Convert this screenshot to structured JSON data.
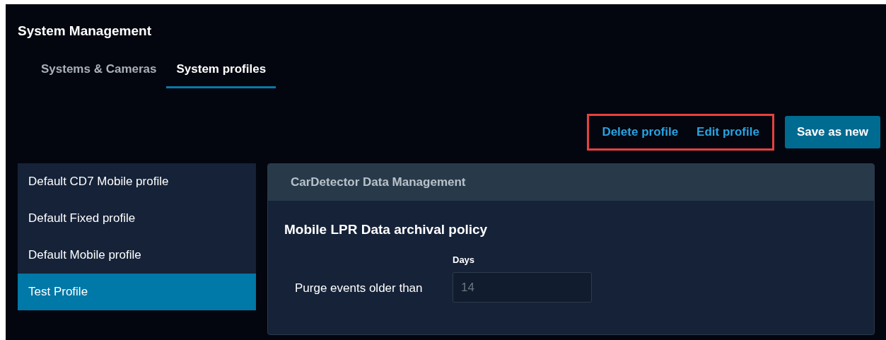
{
  "page": {
    "title": "System Management"
  },
  "tabs": [
    {
      "label": "Systems & Cameras",
      "selected": false
    },
    {
      "label": "System profiles",
      "selected": true
    }
  ],
  "actions": {
    "highlighted": true,
    "links": [
      "Delete profile",
      "Edit profile"
    ],
    "primary": "Save as new"
  },
  "profiles": [
    {
      "label": "Default CD7 Mobile profile",
      "selected": false
    },
    {
      "label": "Default Fixed profile",
      "selected": false
    },
    {
      "label": "Default Mobile profile",
      "selected": false
    },
    {
      "label": "Test Profile",
      "selected": true
    }
  ],
  "panel": {
    "title": "CarDetector Data Management",
    "section_title": "Mobile LPR Data archival policy",
    "field": {
      "label": "Purge events older than",
      "unit_label": "Days",
      "value": "14",
      "disabled": true
    }
  }
}
